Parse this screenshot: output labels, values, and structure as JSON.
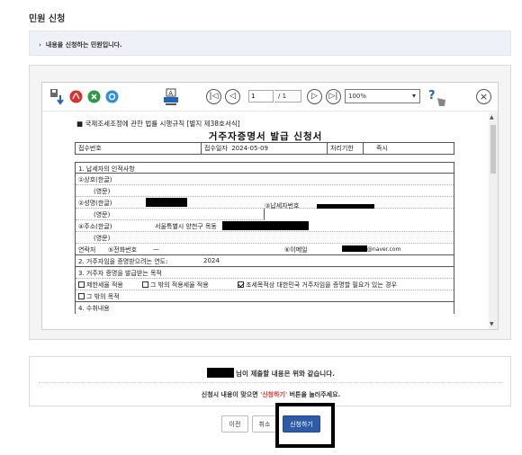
{
  "page": {
    "title": "민원 신청",
    "info_bullet": "›",
    "info_text": "내용을 신청하는 민원입니다."
  },
  "viewer": {
    "toolbar": {
      "save_icon_name": "save-down-icon",
      "pdf_icon_name": "pdf-icon",
      "excel_icon_name": "excel-icon",
      "hwp_icon_name": "hwp-icon",
      "print_icon_name": "print-icon",
      "first_label": "|◁",
      "prev_label": "◁",
      "page_value": "1",
      "page_total": "/ 1",
      "next_label": "▷",
      "last_label": "▷|",
      "zoom_value": "100%",
      "zoom_arrow": "▾",
      "help_label": "?",
      "close_label": "×"
    },
    "document": {
      "form_header": "■ 국제조세조정에 관한 법률 시행규칙 [별지 제38호서식]",
      "form_title": "거주자증명서 발급 신청서",
      "receipt_no_label": "접수번호",
      "receipt_date_label": "접수일자",
      "receipt_date_value": "2024-05-09",
      "processing_period_label": "처리기한",
      "processing_period_value": "즉시",
      "section1_title": "1. 납세자의 인적사항",
      "company_name_label": "①상호(한글)",
      "company_name_en_label": "(영문)",
      "name_label": "②성명(한글)",
      "name_en_label": "(영문)",
      "taxpayer_no_label": "③납세자번호",
      "address_label": "④주소(한글)",
      "address_value": "서울특별시 양천구 목동",
      "address_en_label": "(영문)",
      "contact_label": "연락처",
      "phone_label": "⑤전화번호",
      "phone_value": "—",
      "email_label": "⑥이메일",
      "email_value": "@naver.com",
      "section2_title": "2. 거주자임을 증명받으려는 연도:",
      "section2_value": "2024",
      "section3_title": "3. 거주자 증명을 발급받는 목적",
      "purpose1": "제한세율 적용",
      "purpose2": "그 밖의 적용세율 적용",
      "purpose3": "조세목적상 대한민국 거주자임을 증명할 필요가 있는 경우",
      "purpose4": "그 밖의 목적",
      "section4_partial": "4. 수취내용"
    }
  },
  "notice": {
    "line1": "님이 제출할 내용은 위와 같습니다.",
    "line2_prefix": "신청시 내용이 맞으면",
    "line2_em": "'신청하기'",
    "line2_suffix": "버튼을 눌러주세요."
  },
  "buttons": {
    "prev": "이전",
    "cancel": "취소",
    "submit": "신청하기"
  },
  "colors": {
    "primary_button": "#2e5ba8",
    "info_bg": "#eef2f8",
    "emphasis": "#dd3333"
  }
}
